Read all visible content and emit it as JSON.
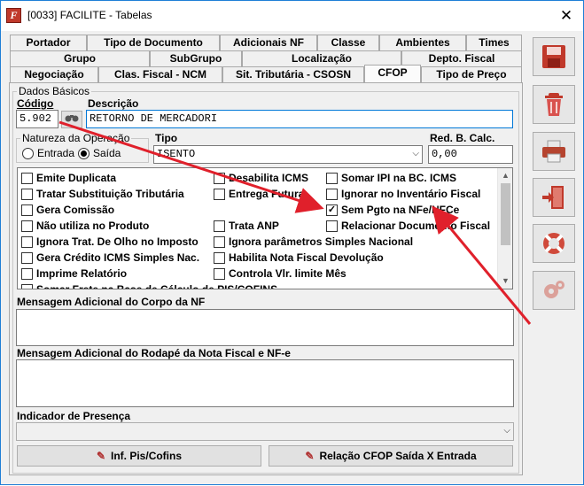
{
  "window": {
    "title": "[0033] FACILITE - Tabelas",
    "app_icon": "F",
    "close_glyph": "✕"
  },
  "tabs": {
    "row1": [
      "Portador",
      "Tipo de Documento",
      "Adicionais NF",
      "Classe",
      "Ambientes",
      "Times"
    ],
    "row2": [
      "Grupo",
      "SubGrupo",
      "Localização",
      "Depto. Fiscal"
    ],
    "row3": [
      "Negociação",
      "Clas. Fiscal - NCM",
      "Sit. Tributária - CSOSN",
      "CFOP",
      "Tipo de Preço"
    ],
    "active": "CFOP"
  },
  "dados": {
    "group_title": "Dados Básicos",
    "codigo_label": "Código",
    "codigo_value": "5.902",
    "descricao_label": "Descrição",
    "descricao_value": "RETORNO DE MERCADORI",
    "natureza_label": "Natureza da Operação",
    "entrada_label": "Entrada",
    "saida_label": "Saída",
    "natureza_selected": "Saída",
    "tipo_label": "Tipo",
    "tipo_value": "ISENTO",
    "red_label": "Red. B. Calc.",
    "red_value": "0,00"
  },
  "checks": [
    {
      "label": "Emite Duplicata",
      "checked": false
    },
    {
      "label": "Desabilita ICMS",
      "checked": false
    },
    {
      "label": "Somar IPI na BC. ICMS",
      "checked": false
    },
    {
      "label": "Tratar Substituição Tributária",
      "checked": false
    },
    {
      "label": "Entrega Futura",
      "checked": false
    },
    {
      "label": "Ignorar no Inventário Fiscal",
      "checked": false
    },
    {
      "label": "Gera Comissão",
      "checked": false
    },
    {
      "label": "Sem Pgto na NFe/NFCe",
      "checked": true
    },
    {
      "label": "Não utiliza no Produto",
      "checked": false
    },
    {
      "label": "Trata ANP",
      "checked": false
    },
    {
      "label": "Relacionar Documento Fiscal",
      "checked": false
    },
    {
      "label": "Ignora Trat. De Olho no Imposto",
      "checked": false
    },
    {
      "label": "Ignora parâmetros Simples Nacional",
      "checked": false
    },
    {
      "label": "Gera Crédito ICMS Simples Nac.",
      "checked": false
    },
    {
      "label": "Habilita Nota Fiscal Devolução",
      "checked": false
    },
    {
      "label": "Imprime Relatório",
      "checked": false
    },
    {
      "label": "Controla Vlr. limite Mês",
      "checked": false
    },
    {
      "label": "Somar Frete na Base de Cálculo de PIS/COFINS",
      "checked": false
    }
  ],
  "mensagem_corpo_label": "Mensagem Adicional do Corpo da NF",
  "mensagem_rodape_label": "Mensagem Adicional do Rodapé da Nota Fiscal e NF-e",
  "indicador_label": "Indicador de Presença",
  "indicador_value": "",
  "buttons": {
    "pis_cofins": "Inf. Pis/Cofins",
    "relacao": "Relação CFOP Saída X Entrada"
  },
  "side_icons": [
    "save-icon",
    "trash-icon",
    "printer-icon",
    "exit-door-icon",
    "lifebuoy-icon",
    "settings-gears-icon"
  ],
  "colors": {
    "arrow": "#e0202b",
    "focus": "#0078d7"
  }
}
